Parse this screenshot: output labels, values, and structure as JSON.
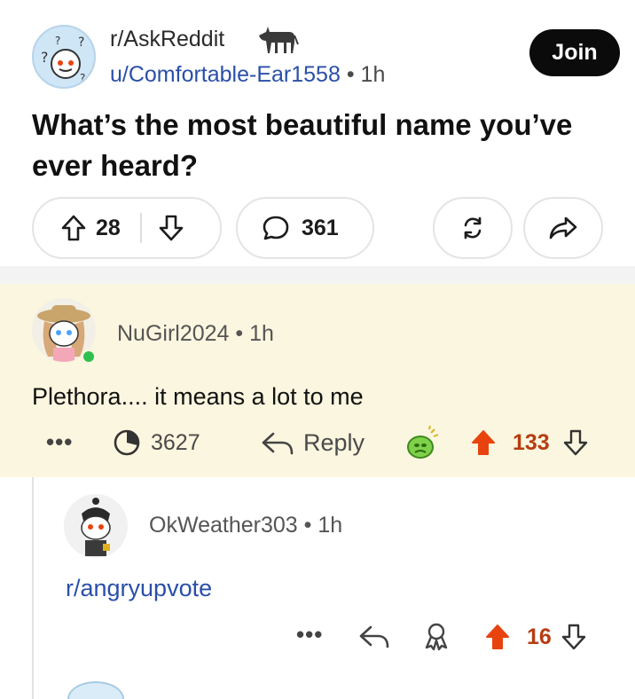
{
  "post": {
    "subreddit": "r/AskReddit",
    "author": "u/Comfortable-Ear1558",
    "separator": "•",
    "time": "1h",
    "join_label": "Join",
    "title": "What’s the most beautiful name you’ve ever heard?",
    "upvotes": "28",
    "comments": "361"
  },
  "comment1": {
    "author": "NuGirl2024",
    "separator": "•",
    "time": "1h",
    "body": "Plethora.... it means a lot to me",
    "more": "•••",
    "timer_count": "3627",
    "reply_label": "Reply",
    "score": "133"
  },
  "comment2": {
    "author": "OkWeather303",
    "separator": "•",
    "time": "1h",
    "body": "r/angryupvote",
    "more": "•••",
    "score": "16"
  },
  "colors": {
    "upvote_active": "#e8430f",
    "score_text": "#b63d12",
    "link_blue": "#2a4fa8",
    "highlight_bg": "#fbf6df",
    "join_bg": "#0b0b0b"
  }
}
